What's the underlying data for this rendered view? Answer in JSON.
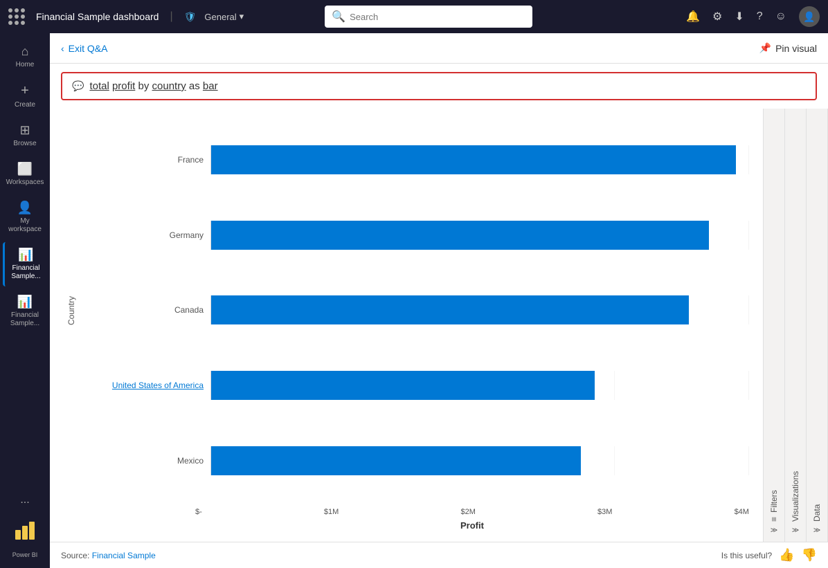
{
  "topnav": {
    "app_title": "Financial Sample dashboard",
    "divider": "|",
    "shield_icon": "🛡",
    "general_label": "General",
    "chevron_icon": "▾",
    "search_placeholder": "Search",
    "search_icon": "🔍",
    "bell_icon": "🔔",
    "gear_icon": "⚙",
    "download_icon": "⬇",
    "help_icon": "?",
    "smiley_icon": "☺",
    "avatar_icon": "👤"
  },
  "sidebar": {
    "items": [
      {
        "id": "home",
        "icon": "⌂",
        "label": "Home",
        "active": false
      },
      {
        "id": "create",
        "icon": "+",
        "label": "Create",
        "active": false
      },
      {
        "id": "browse",
        "icon": "⊞",
        "label": "Browse",
        "active": false
      },
      {
        "id": "workspaces",
        "icon": "⬜",
        "label": "Workspaces",
        "active": false
      },
      {
        "id": "my-workspace",
        "icon": "👤",
        "label": "My workspace",
        "active": false
      },
      {
        "id": "financial-sample-1",
        "icon": "📊",
        "label": "Financial Sample...",
        "active": true
      },
      {
        "id": "financial-sample-2",
        "icon": "📊",
        "label": "Financial Sample...",
        "active": false
      }
    ],
    "more_label": "...",
    "powerbi_label": "Power BI"
  },
  "content": {
    "exit_qa_label": "Exit Q&A",
    "back_icon": "‹",
    "pin_icon": "📌",
    "pin_visual_label": "Pin visual",
    "qa_query": "total profit by country as bar",
    "qa_icon": "💬",
    "qa_underline_words": [
      "total",
      "profit",
      "country",
      "bar"
    ],
    "chart": {
      "title": "total profit by country as bar",
      "y_axis_label": "Country",
      "x_axis_label": "Profit",
      "x_ticks": [
        "$-",
        "$1M",
        "$2M",
        "$3M",
        "$4M"
      ],
      "bars": [
        {
          "country": "France",
          "value": 3.9,
          "max": 4.0,
          "highlight": false
        },
        {
          "country": "Germany",
          "value": 3.7,
          "max": 4.0,
          "highlight": false
        },
        {
          "country": "Canada",
          "value": 3.55,
          "max": 4.0,
          "highlight": false
        },
        {
          "country": "United States of America",
          "value": 2.85,
          "max": 4.0,
          "highlight": true
        },
        {
          "country": "Mexico",
          "value": 2.75,
          "max": 4.0,
          "highlight": false
        }
      ]
    },
    "side_panels": [
      {
        "label": "Filters",
        "icon": "≡"
      },
      {
        "label": "Visualizations",
        "icon": "‹"
      },
      {
        "label": "Data",
        "icon": "‹"
      }
    ],
    "footer": {
      "source_prefix": "Source: ",
      "source_link_text": "Financial Sample",
      "feedback_label": "Is this useful?",
      "thumbs_up": "👍",
      "thumbs_down": "👎"
    }
  }
}
